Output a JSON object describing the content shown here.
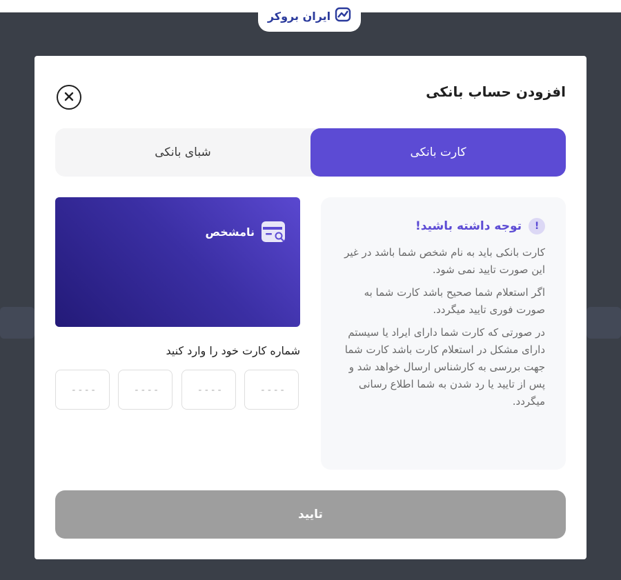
{
  "brand": {
    "logo_text": "ایران بروکر",
    "logo_color": "#2a3a9c"
  },
  "dialog": {
    "title": "افزودن حساب بانکی",
    "tabs": [
      {
        "label": "کارت بانکی",
        "active": true
      },
      {
        "label": "شبای بانکی",
        "active": false
      }
    ],
    "notice": {
      "title": "توجه داشته باشید!",
      "icon_text": "!",
      "paragraphs": [
        "کارت بانکی باید به نام شخص شما باشد در غیر این صورت تایید نمی شود.",
        "اگر استعلام شما صحیح باشد کارت شما به صورت فوری تایید میگردد.",
        "در صورتی که کارت شما دارای ایراد یا سیستم دارای مشکل در استعلام کارت باشد کارت شما جهت بررسی به کارشناس ارسال خواهد شد و پس از تایید یا رد شدن به شما اطلاع رسانی میگردد."
      ]
    },
    "card": {
      "status_label": "نامشخص",
      "icon": "card-search-icon"
    },
    "card_number_label": "شماره کارت خود را وارد کنید",
    "card_inputs": [
      {
        "value": "",
        "placeholder": "----"
      },
      {
        "value": "",
        "placeholder": "----"
      },
      {
        "value": "",
        "placeholder": "----"
      },
      {
        "value": "",
        "placeholder": "----"
      }
    ],
    "confirm_label": "تایید"
  },
  "colors": {
    "accent": "#5c4bd4",
    "overlay": "#3a3f48",
    "disabled_button": "#9e9e9e"
  }
}
